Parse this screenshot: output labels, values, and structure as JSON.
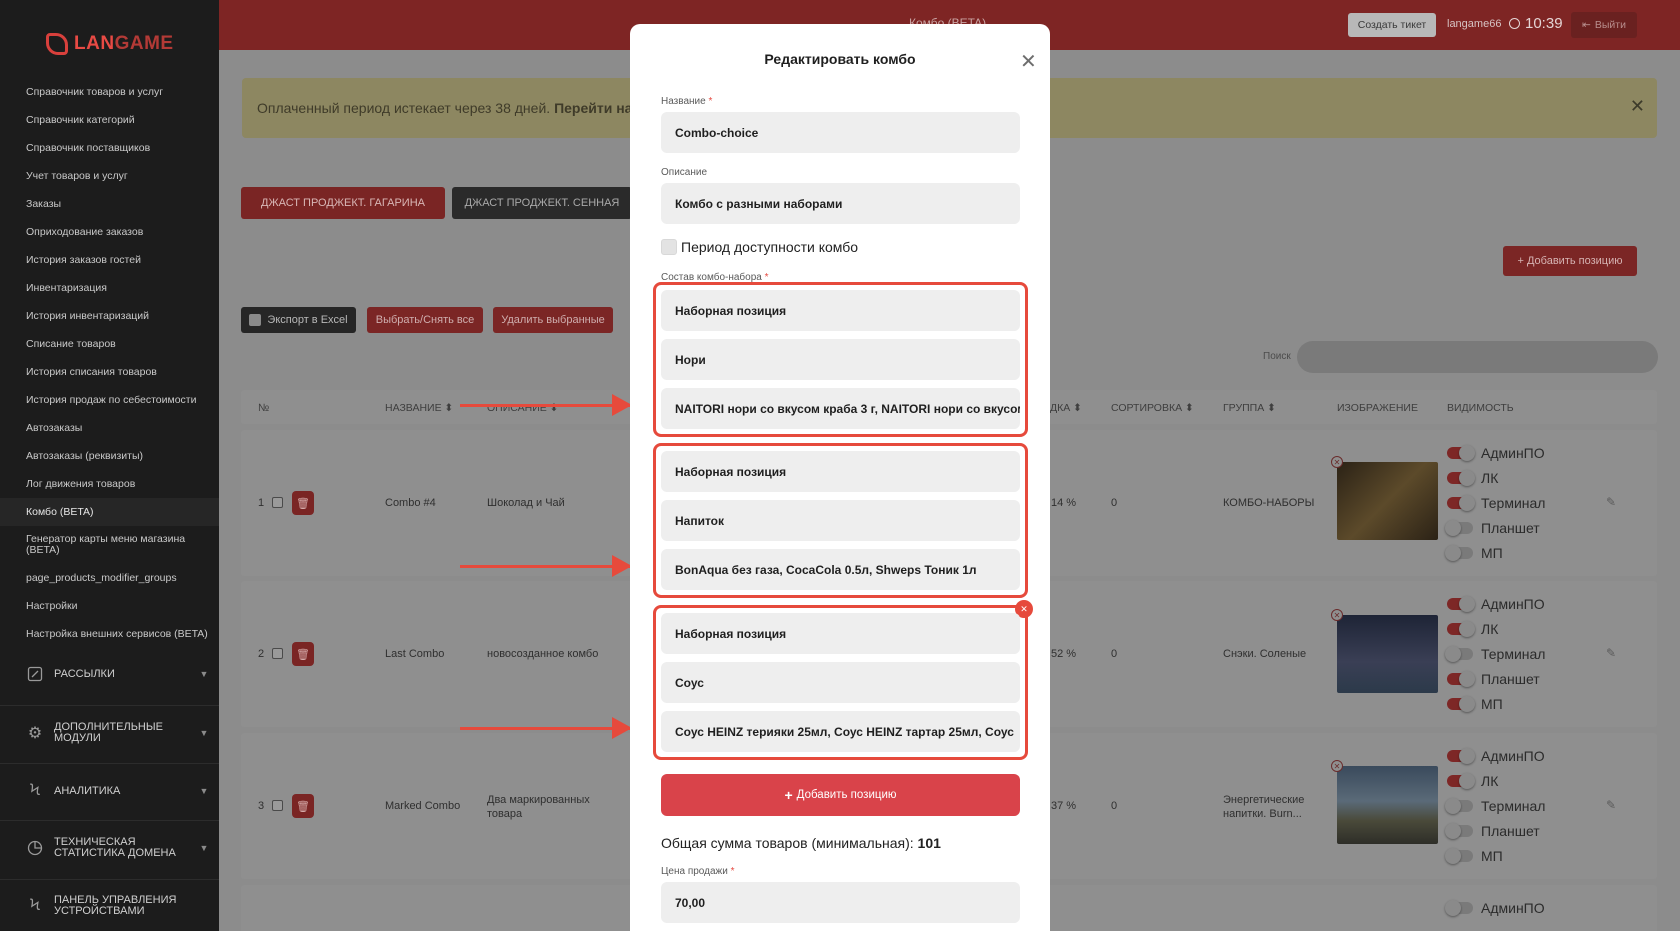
{
  "brand": {
    "part_a": "LAN",
    "part_b": "GAME",
    "accent": "#d8403c"
  },
  "sidebar": {
    "items": [
      "Справочник товаров и услуг",
      "Справочник категорий",
      "Справочник поставщиков",
      "Учет товаров и услуг",
      "Заказы",
      "Оприходование заказов",
      "История заказов гостей",
      "Инвентаризация",
      "История инвентаризаций",
      "Списание товаров",
      "История списания товаров",
      "История продаж по себестоимости",
      "Автозаказы",
      "Автозаказы (реквизиты)",
      "Лог движения товаров",
      "Комбо (BETA)",
      "Генератор карты меню магазина (BETA)",
      "page_products_modifier_groups",
      "Настройки",
      "Настройка внешних сервисов (BETA)"
    ],
    "active_index": 15,
    "sections": [
      {
        "label": "Рассылки",
        "icon": "edit-square-icon"
      },
      {
        "label": "Дополнительные модули",
        "icon": "gear-icon"
      },
      {
        "label": "Аналитика",
        "icon": "lightning-icon"
      },
      {
        "label": "Техническая статистика домена",
        "icon": "pie-chart-icon"
      },
      {
        "label": "Панель управления устройствами",
        "icon": "lightning-icon"
      }
    ]
  },
  "topbar": {
    "title": "Комбо (BETA)",
    "ticket_button": "Создать тикет",
    "user": "langame66",
    "time": "10:39",
    "exit_button": "Выйти"
  },
  "notice": {
    "text": "Оплаченный период истекает через 38 дней.",
    "link": "Перейти на"
  },
  "tabs": [
    "ДЖАСТ ПРОДЖЕКТ. ГАГАРИНА",
    "ДЖАСТ ПРОДЖЕКТ. СЕННАЯ"
  ],
  "toolbar": {
    "add_position": "Добавить позицию",
    "export": "Экспорт в Excel",
    "select_all": "Выбрать/Снять все",
    "delete_selected": "Удалить выбранные",
    "search_label": "Поиск"
  },
  "table": {
    "headers": {
      "num": "№",
      "name": "НАЗВАНИЕ",
      "desc": "ОПИСАНИЕ",
      "discount": "ДКА",
      "sort": "СОРТИРОВКА",
      "group": "ГРУППА",
      "image": "ИЗОБРАЖЕНИЕ",
      "visibility": "ВИДИМОСТЬ"
    },
    "rows": [
      {
        "num": "1",
        "name": "Combo #4",
        "desc": "Шоколад и Чай",
        "discount": "14 %",
        "sort": "0",
        "group": "КОМБО-НАБОРЫ",
        "visibility": [
          [
            "АдминПО",
            true
          ],
          [
            "ЛК",
            true
          ],
          [
            "Терминал",
            true
          ],
          [
            "Планшет",
            false
          ],
          [
            "МП",
            false
          ]
        ]
      },
      {
        "num": "2",
        "name": "Last Combo",
        "desc": "новосозданное комбо",
        "discount": "52 %",
        "sort": "0",
        "group": "Снэки. Соленые",
        "visibility": [
          [
            "АдминПО",
            true
          ],
          [
            "ЛК",
            true
          ],
          [
            "Терминал",
            false
          ],
          [
            "Планшет",
            true
          ],
          [
            "МП",
            true
          ]
        ]
      },
      {
        "num": "3",
        "name": "Marked Combo",
        "desc": "Два маркированных товара",
        "discount": "37 %",
        "sort": "0",
        "group": "Энергетические напитки. Burn...",
        "visibility": [
          [
            "АдминПО",
            true
          ],
          [
            "ЛК",
            true
          ],
          [
            "Терминал",
            false
          ],
          [
            "Планшет",
            false
          ],
          [
            "МП",
            false
          ]
        ]
      }
    ],
    "partial_row_visibility": "АдминПО"
  },
  "modal": {
    "title": "Редактировать комбо",
    "name_label": "Название",
    "name_value": "Combo-choice",
    "desc_label": "Описание",
    "desc_value": "Комбо с разными наборами",
    "period_label": "Период доступности комбо",
    "composition_label": "Состав комбо-набора",
    "groups": [
      {
        "type": "Наборная позиция",
        "category": "Нори",
        "items": "NAITORI нори со вкусом краба 3 г, NAITORI нори со вкусом"
      },
      {
        "type": "Наборная позиция",
        "category": "Напиток",
        "items": "BonAqua без газа, CocaCola 0.5л, Shweps Тоник 1л"
      },
      {
        "type": "Наборная позиция",
        "category": "Соус",
        "items": "Соус HEINZ терияки 25мл, Соус HEINZ тартар 25мл, Соус"
      }
    ],
    "add_button": "Добавить позицию",
    "total_label": "Общая сумма товаров (минимальная):",
    "total_value": "101",
    "price_label": "Цена продажи",
    "price_value": "70,00"
  },
  "colors": {
    "highlight": "#e64a3c",
    "primary": "#d9434a"
  }
}
